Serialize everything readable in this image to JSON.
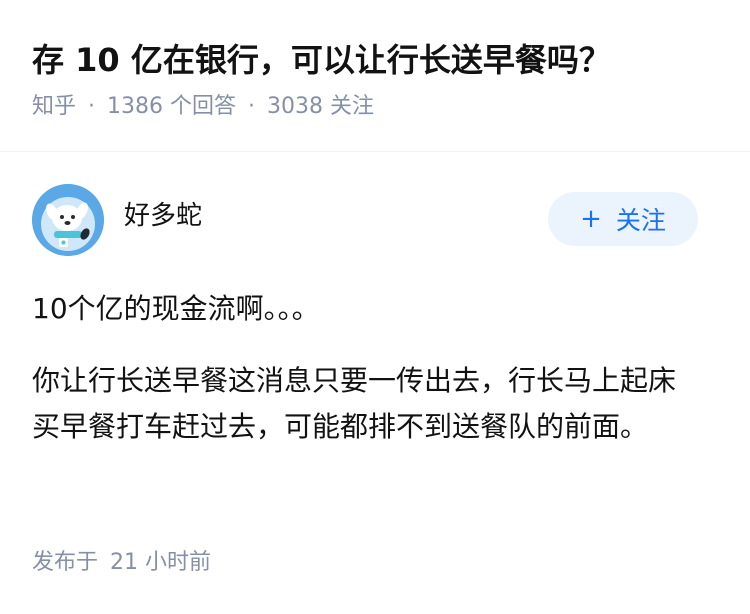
{
  "question": {
    "title": "存 10 亿在银行，可以让行长送早餐吗？",
    "source": "知乎",
    "separator": "·",
    "answer_count": "1386",
    "answer_label": "个回答",
    "follower_count": "3038",
    "follower_label": "关注"
  },
  "author": {
    "name": "好多蛇",
    "avatar_icon": "cartoon-dog-avatar-icon",
    "follow_plus": "+",
    "follow_label": "关注"
  },
  "answer": {
    "paragraphs": [
      "10个亿的现金流啊。。。",
      "你让行长送早餐这消息只要一传出去，行长马上起床买早餐打车赶过去，可能都排不到送餐队的前面。"
    ],
    "published_label": "发布于",
    "published_time": "21 小时前"
  },
  "colors": {
    "title": "#121212",
    "meta": "#8590a6",
    "follow_bg": "#ebf3fd",
    "follow_text": "#1772f6",
    "avatar_bg": "#5aa9e6"
  }
}
